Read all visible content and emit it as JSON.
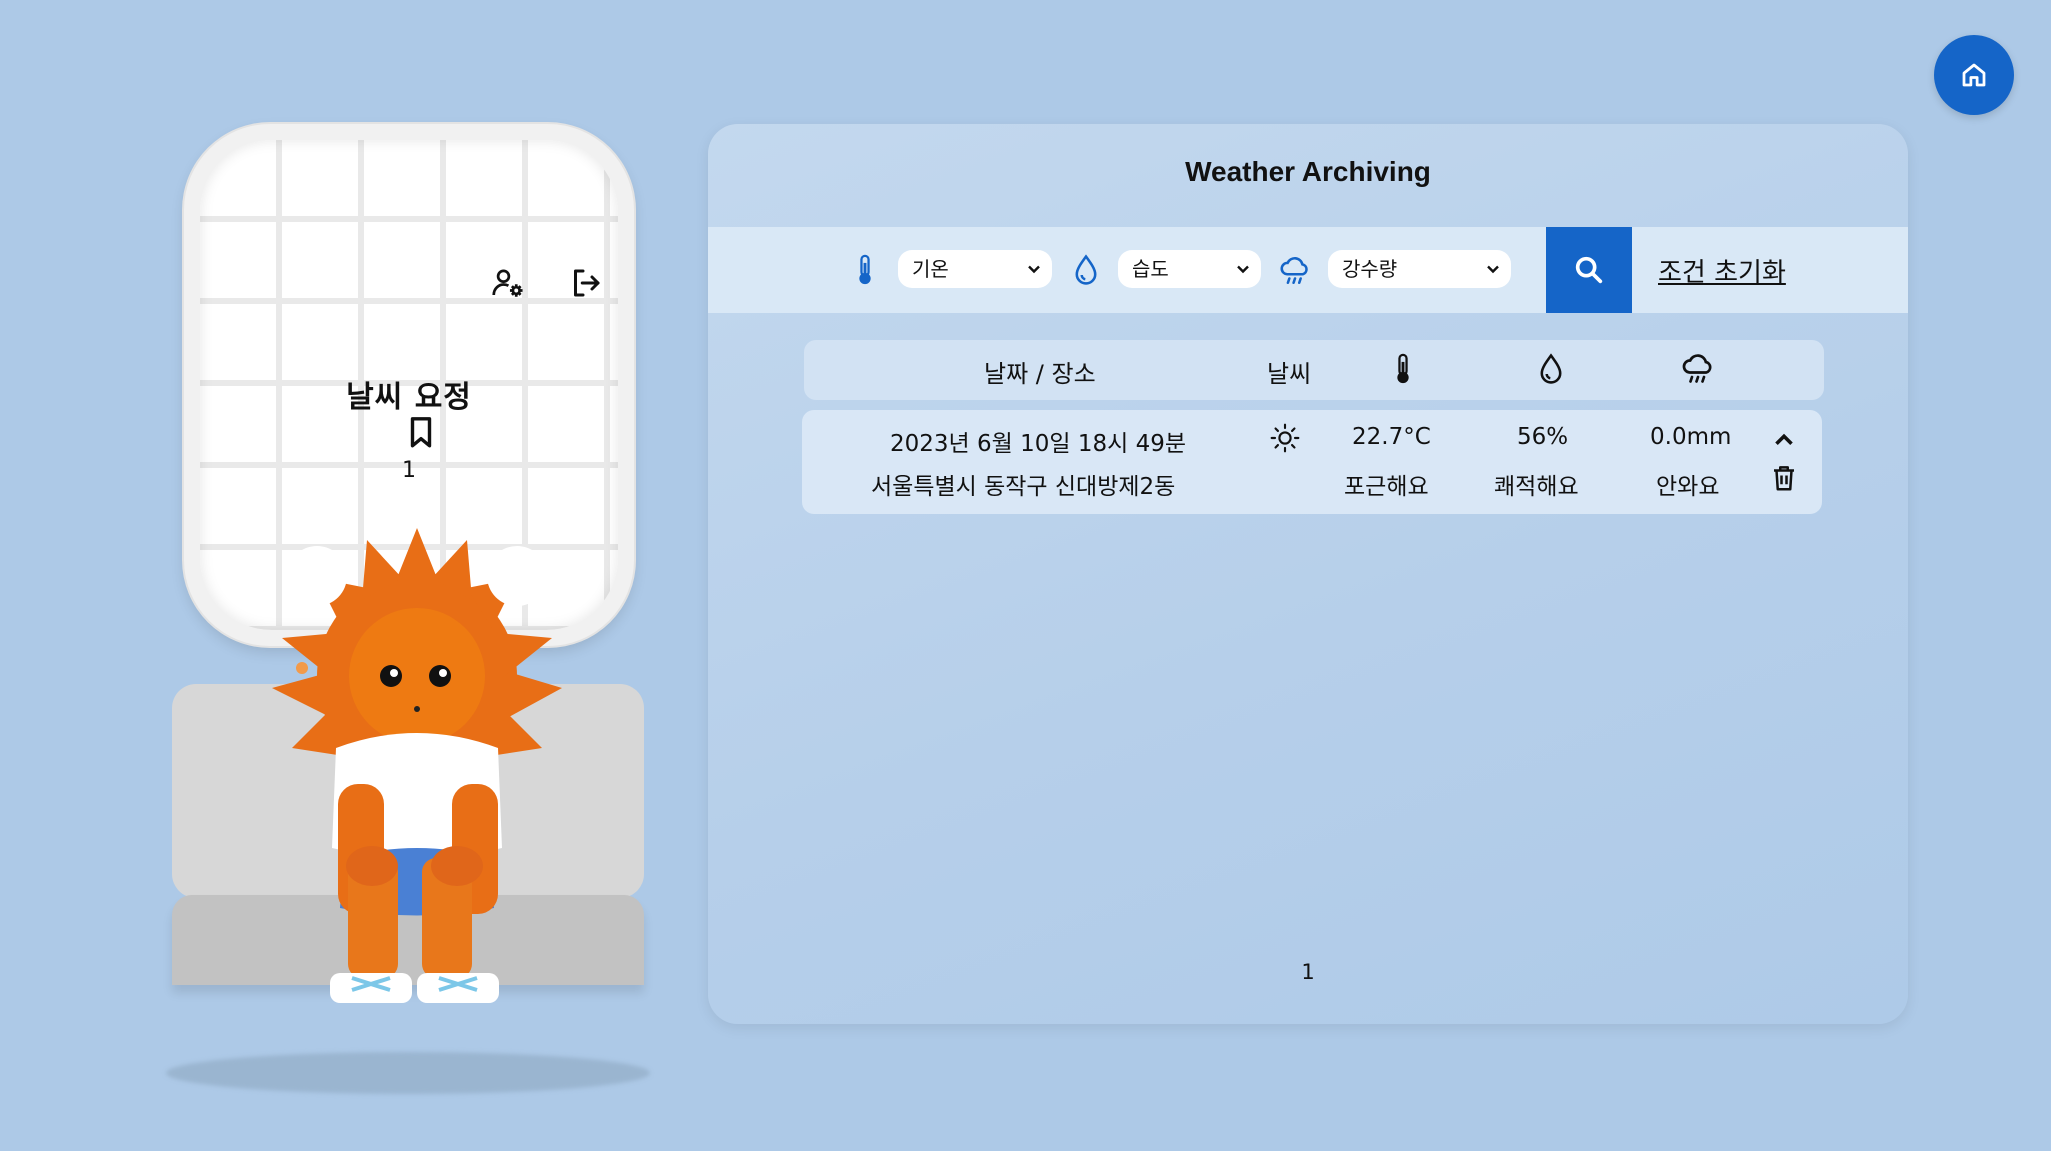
{
  "app": {
    "title": "Weather Archiving",
    "home_icon": "home-icon"
  },
  "profile": {
    "nickname": "날씨 요정",
    "bookmark_count": "1",
    "settings_icon": "user-settings-icon",
    "logout_icon": "logout-icon",
    "bookmark_icon": "bookmark-icon"
  },
  "filters": {
    "temperature": {
      "icon": "thermometer-icon",
      "selected": "기온"
    },
    "humidity": {
      "icon": "water-drop-icon",
      "selected": "습도"
    },
    "precipitation": {
      "icon": "rain-cloud-icon",
      "selected": "강수량"
    },
    "search_icon": "search-icon",
    "reset_label": "조건 초기화"
  },
  "table": {
    "headers": {
      "date_place": "날짜 / 장소",
      "weather": "날씨",
      "temp_icon": "thermometer-icon",
      "humidity_icon": "water-drop-icon",
      "precip_icon": "rain-cloud-icon"
    },
    "rows": [
      {
        "datetime": "2023년 6월 10일 18시 49분",
        "place": "서울특별시 동작구 신대방제2동",
        "weather_icon": "sun-icon",
        "temperature": "22.7°C",
        "temp_feel": "포근해요",
        "humidity": "56%",
        "humidity_feel": "쾌적해요",
        "precipitation": "0.0mm",
        "precip_feel": "안와요"
      }
    ]
  },
  "pagination": {
    "current": "1"
  },
  "colors": {
    "background": "#adc9e7",
    "accent": "#1565c8",
    "sun_orange": "#e86e16"
  }
}
